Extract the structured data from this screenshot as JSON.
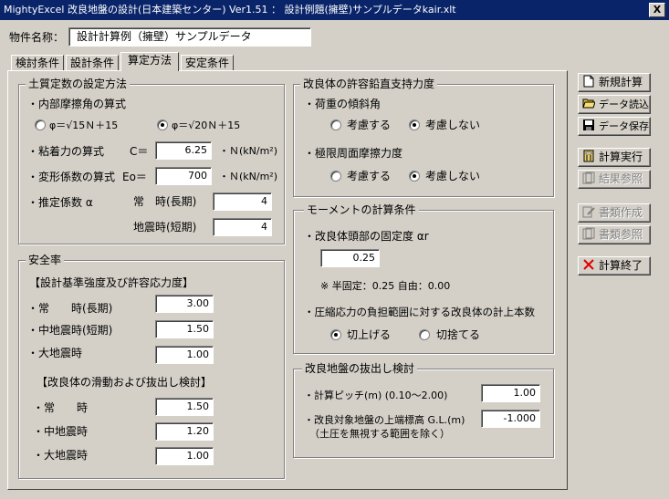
{
  "window": {
    "title": "MightyExcel 改良地盤の設計(日本建築センター) Ver1.51 ： 設計例題(擁壁)サンプルデータkair.xlt",
    "close": "X"
  },
  "property": {
    "label": "物件名称：",
    "value": "設計計算例（擁壁）サンプルデータ"
  },
  "tabs": [
    "検討条件",
    "設計条件",
    "算定方法",
    "安定条件"
  ],
  "soil": {
    "title": "土質定数の設定方法",
    "friction_label": "・内部摩擦角の算式",
    "friction_opt1": "φ＝√15Ｎ＋15",
    "friction_opt2": "φ＝√20Ｎ＋15",
    "friction_selected": 2,
    "cohesion_label": "・粘着力の算式",
    "cohesion_sym": "C＝",
    "cohesion_value": "6.25",
    "cohesion_unit": "・Ｎ(kN/m²)",
    "modulus_label": "・変形係数の算式",
    "modulus_sym": "Eo＝",
    "modulus_value": "700",
    "modulus_unit": "・Ｎ(kN/m²)",
    "coef_label": "・推定係数 α",
    "coef_normal_label": "常　時(長期)",
    "coef_normal_value": "4",
    "coef_quake_label": "地震時(短期)",
    "coef_quake_value": "4"
  },
  "safety": {
    "title": "安全率",
    "sub1": "【設計基準強度及び許容応力度】",
    "r1_label": "・常　　時(長期)",
    "r1_value": "3.00",
    "r2_label": "・中地震時(短期)",
    "r2_value": "1.50",
    "r3_label": "・大地震時",
    "r3_value": "1.00",
    "sub2": "【改良体の滑動および抜出し検討】",
    "r4_label": "・常　　時",
    "r4_value": "1.50",
    "r5_label": "・中地震時",
    "r5_value": "1.20",
    "r6_label": "・大地震時",
    "r6_value": "1.00"
  },
  "bearing": {
    "title": "改良体の許容鉛直支持力度",
    "load_label": "・荷重の傾斜角",
    "load_opt1": "考慮する",
    "load_opt2": "考慮しない",
    "load_selected": 2,
    "skin_label": "・極限周面摩擦力度",
    "skin_opt1": "考慮する",
    "skin_opt2": "考慮しない",
    "skin_selected": 2
  },
  "moment": {
    "title": "モーメントの計算条件",
    "fix_label": "・改良体頭部の固定度 αr",
    "fix_value": "0.25",
    "note": "※ 半固定：0.25 自由：0.00",
    "count_label": "・圧縮応力の負担範囲に対する改良体の計上本数",
    "round_opt1": "切上げる",
    "round_opt2": "切捨てる",
    "round_selected": 1
  },
  "pullout": {
    "title": "改良地盤の抜出し検討",
    "pitch_label": "・計算ピッチ(m) (0.10～2.00)",
    "pitch_value": "1.00",
    "top_label": "・改良対象地盤の上端標高 G.L.(m)",
    "top_value": "-1.000",
    "top_note": "（土圧を無視する範囲を除く）"
  },
  "buttons": {
    "new": "新規計算",
    "load": "データ読込",
    "save": "データ保存",
    "calc": "計算実行",
    "result": "結果参照",
    "doc_make": "書類作成",
    "doc_ref": "書類参照",
    "exit": "計算終了"
  },
  "colors": {
    "titlebar": "#0a246a",
    "face": "#d4d0c8",
    "exit_icon": "#e00000"
  }
}
